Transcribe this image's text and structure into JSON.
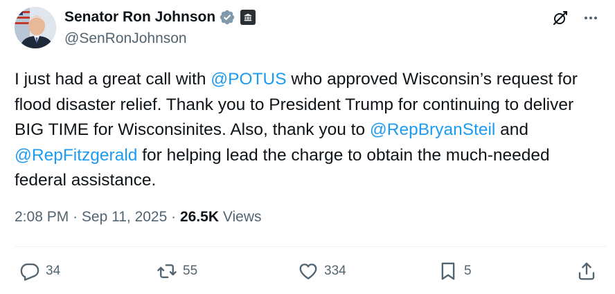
{
  "author": {
    "name": "Senator Ron Johnson",
    "handle": "@SenRonJohnson",
    "verified_icon": "verified-badge-icon",
    "affiliation_icon": "government-building-icon"
  },
  "top_actions": {
    "grok_icon": "grok-icon",
    "more_icon": "more-icon"
  },
  "tweet": {
    "segments": [
      {
        "text": "I just had a great call with ",
        "mention": false
      },
      {
        "text": "@POTUS",
        "mention": true
      },
      {
        "text": " who approved Wisconsin’s request for flood disaster relief. Thank you to President Trump for continuing to deliver BIG TIME for Wisconsinites. Also, thank you to ",
        "mention": false
      },
      {
        "text": "@RepBryanSteil",
        "mention": true
      },
      {
        "text": " and ",
        "mention": false
      },
      {
        "text": "@RepFitzgerald",
        "mention": true
      },
      {
        "text": " for helping lead the charge to obtain the much-needed federal assistance.",
        "mention": false
      }
    ]
  },
  "meta": {
    "time": "2:08 PM",
    "separator": "·",
    "date": "Sep 11, 2025",
    "views_count": "26.5K",
    "views_label": "Views"
  },
  "actions": {
    "replies": "34",
    "reposts": "55",
    "likes": "334",
    "bookmarks": "5"
  },
  "colors": {
    "text": "#0f1419",
    "secondary": "#536471",
    "mention": "#1d9bf0",
    "divider": "#eff3f4",
    "verified": "#829aab"
  }
}
